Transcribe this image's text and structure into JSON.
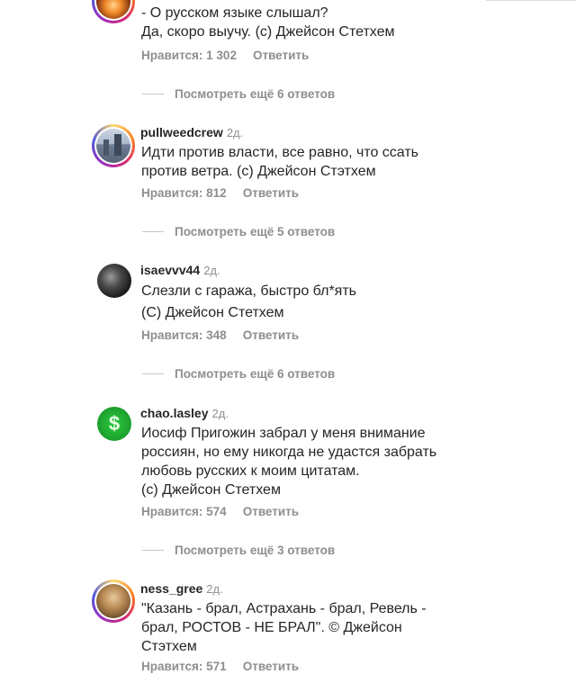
{
  "comments": [
    {
      "username": "",
      "time": "",
      "lines": [
        "- О русском языке слышал?",
        "Да, скоро выучу. (с) Джейсон Стетхем"
      ],
      "likes": "Нравится: 1 302",
      "reply": "Ответить",
      "more": "Посмотреть ещё 6 ответов",
      "avatar": "fire-avatar"
    },
    {
      "username": "pullweedcrew",
      "time": "2д.",
      "lines": [
        "Идти против власти, все равно, что ссать",
        "против ветра. (с) Джейсон Стэтхем"
      ],
      "likes": "Нравится: 812",
      "reply": "Ответить",
      "more": "Посмотреть ещё 5 ответов",
      "avatar": "city-avatar"
    },
    {
      "username": "isaevvv44",
      "time": "2д.",
      "lines": [
        "Слезли с гаража, быстро бл*ять",
        "(С) Джейсон Стетхем"
      ],
      "likes": "Нравится: 348",
      "reply": "Ответить",
      "more": "Посмотреть ещё 6 ответов",
      "avatar": "dark-avatar"
    },
    {
      "username": "chao.lasley",
      "time": "2д.",
      "lines": [
        "Иосиф Пригожин забрал у меня внимание",
        "россиян, но ему никогда не удастся забрать",
        "любовь русских к моим цитатам.",
        "(с) Джейсон Стетхем"
      ],
      "likes": "Нравится: 574",
      "reply": "Ответить",
      "more": "Посмотреть ещё 3 ответов",
      "avatar": "dollar-avatar",
      "avatar_glyph": "$"
    },
    {
      "username": "ness_gree",
      "time": "2д.",
      "lines": [
        "\"Казань - брал, Астрахань -  брал, Ревель -",
        "брал, РОСТОВ - НЕ БРАЛ\".  © Джейсон",
        "Стэтхем"
      ],
      "likes": "Нравится: 571",
      "reply": "Ответить",
      "avatar": "gold-avatar"
    }
  ],
  "colors": {
    "text": "#262626",
    "secondary": "#8e8e8e",
    "divider": "#c7c7c7"
  }
}
